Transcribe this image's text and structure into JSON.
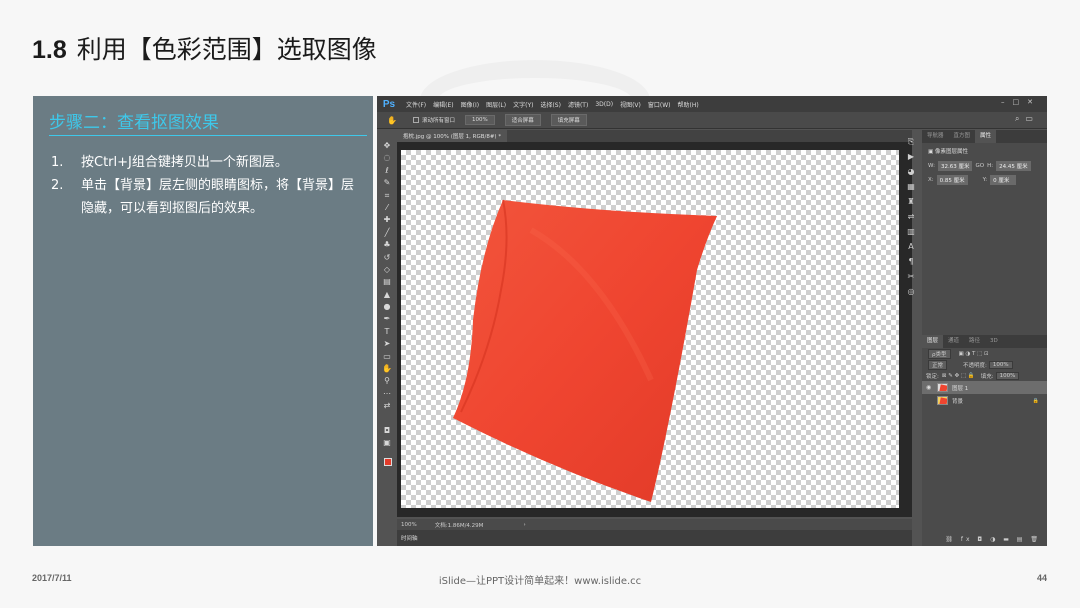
{
  "slide": {
    "number": "1.8",
    "title": "利用【色彩范围】选取图像",
    "date": "2017/7/11",
    "footer": "iSlide—让PPT设计简单起来！www.islide.cc",
    "page": "44"
  },
  "left_panel": {
    "heading": "步骤二：查看抠图效果",
    "steps": [
      {
        "no": "1.",
        "text": "按Ctrl+J组合键拷贝出一个新图层。"
      },
      {
        "no": "2.",
        "text": "单击【背景】层左侧的眼睛图标，将【背景】层隐藏，可以看到抠图后的效果。"
      }
    ]
  },
  "photoshop": {
    "logo": "Ps",
    "menus": [
      "文件(F)",
      "编辑(E)",
      "图像(I)",
      "图层(L)",
      "文字(Y)",
      "选择(S)",
      "滤镜(T)",
      "3D(D)",
      "视图(V)",
      "窗口(W)",
      "帮助(H)"
    ],
    "options": {
      "scroll_all_label": "滚动所有窗口",
      "zoom_value": "100%",
      "fit_screen": "适合屏幕",
      "fill_screen": "填充屏幕"
    },
    "document_tab": "抱枕.jpg @ 100% (图层 1, RGB/8#) *",
    "status": {
      "zoom": "100%",
      "doc_size": "文档:1.86M/4.29M"
    },
    "timeline_label": "时间轴",
    "panel_tabs": [
      "导航器",
      "直方图",
      "属性"
    ],
    "properties": {
      "title": "像素图层属性",
      "w_label": "W:",
      "w_value": "32.63 厘米",
      "link": "GO",
      "h_label": "H:",
      "h_value": "24.45 厘米",
      "x_label": "X:",
      "x_value": "0.85 厘米",
      "y_label": "Y:",
      "y_value": "0 厘米"
    },
    "layers_panel": {
      "tabs": [
        "图层",
        "通道",
        "路径",
        "3D"
      ],
      "kind_label": "ρ类型",
      "blend_mode": "正常",
      "opacity_label": "不透明度:",
      "opacity_value": "100%",
      "lock_label": "锁定:",
      "fill_label": "填充:",
      "fill_value": "100%",
      "layers": [
        {
          "name": "图层 1",
          "visible": true,
          "selected": true
        },
        {
          "name": "背景",
          "visible": false,
          "selected": false
        }
      ]
    }
  },
  "colors": {
    "panel_bg": "#6b7c84",
    "accent": "#3ec8ea",
    "pillow": "#ef4530"
  }
}
